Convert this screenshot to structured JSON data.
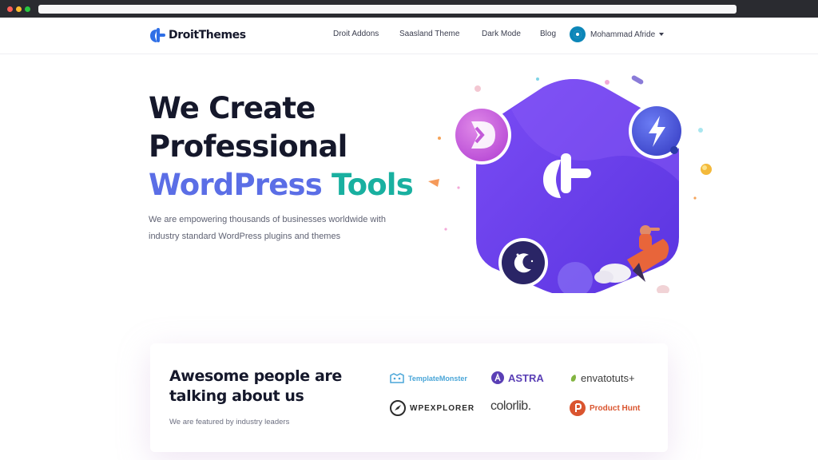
{
  "header": {
    "logo_text": "DroitThemes",
    "nav": [
      "Droit Addons",
      "Saasland Theme",
      "Dark Mode",
      "Blog"
    ],
    "user_name": "Mohammad Afride"
  },
  "hero": {
    "title_line1": "We Create",
    "title_line2": "Professional",
    "title_word1": "WordPress",
    "title_word2": "Tools",
    "subtitle_line1": "We are empowering thousands of businesses worldwide with",
    "subtitle_line2": "industry standard WordPress plugins and themes"
  },
  "featured": {
    "title_line1": "Awesome people are",
    "title_line2": "talking about us",
    "subtitle": "We are featured by industry leaders",
    "brands": [
      {
        "name": "TemplateMonster",
        "icon": "template-monster-icon"
      },
      {
        "name": "ASTRA",
        "icon": "astra-icon"
      },
      {
        "name": "envatotuts+",
        "icon": "envato-leaf-icon"
      },
      {
        "name": "WPEXPLORER",
        "icon": "wpexplorer-compass-icon"
      },
      {
        "name": "colorlib.",
        "icon": ""
      },
      {
        "name": "Product Hunt",
        "icon": "product-hunt-icon"
      }
    ]
  },
  "colors": {
    "primary": "#5b6ee6",
    "accent_teal": "#19b0a0",
    "hex_purple": "#6a3ff0",
    "dark_text": "#15182b"
  }
}
